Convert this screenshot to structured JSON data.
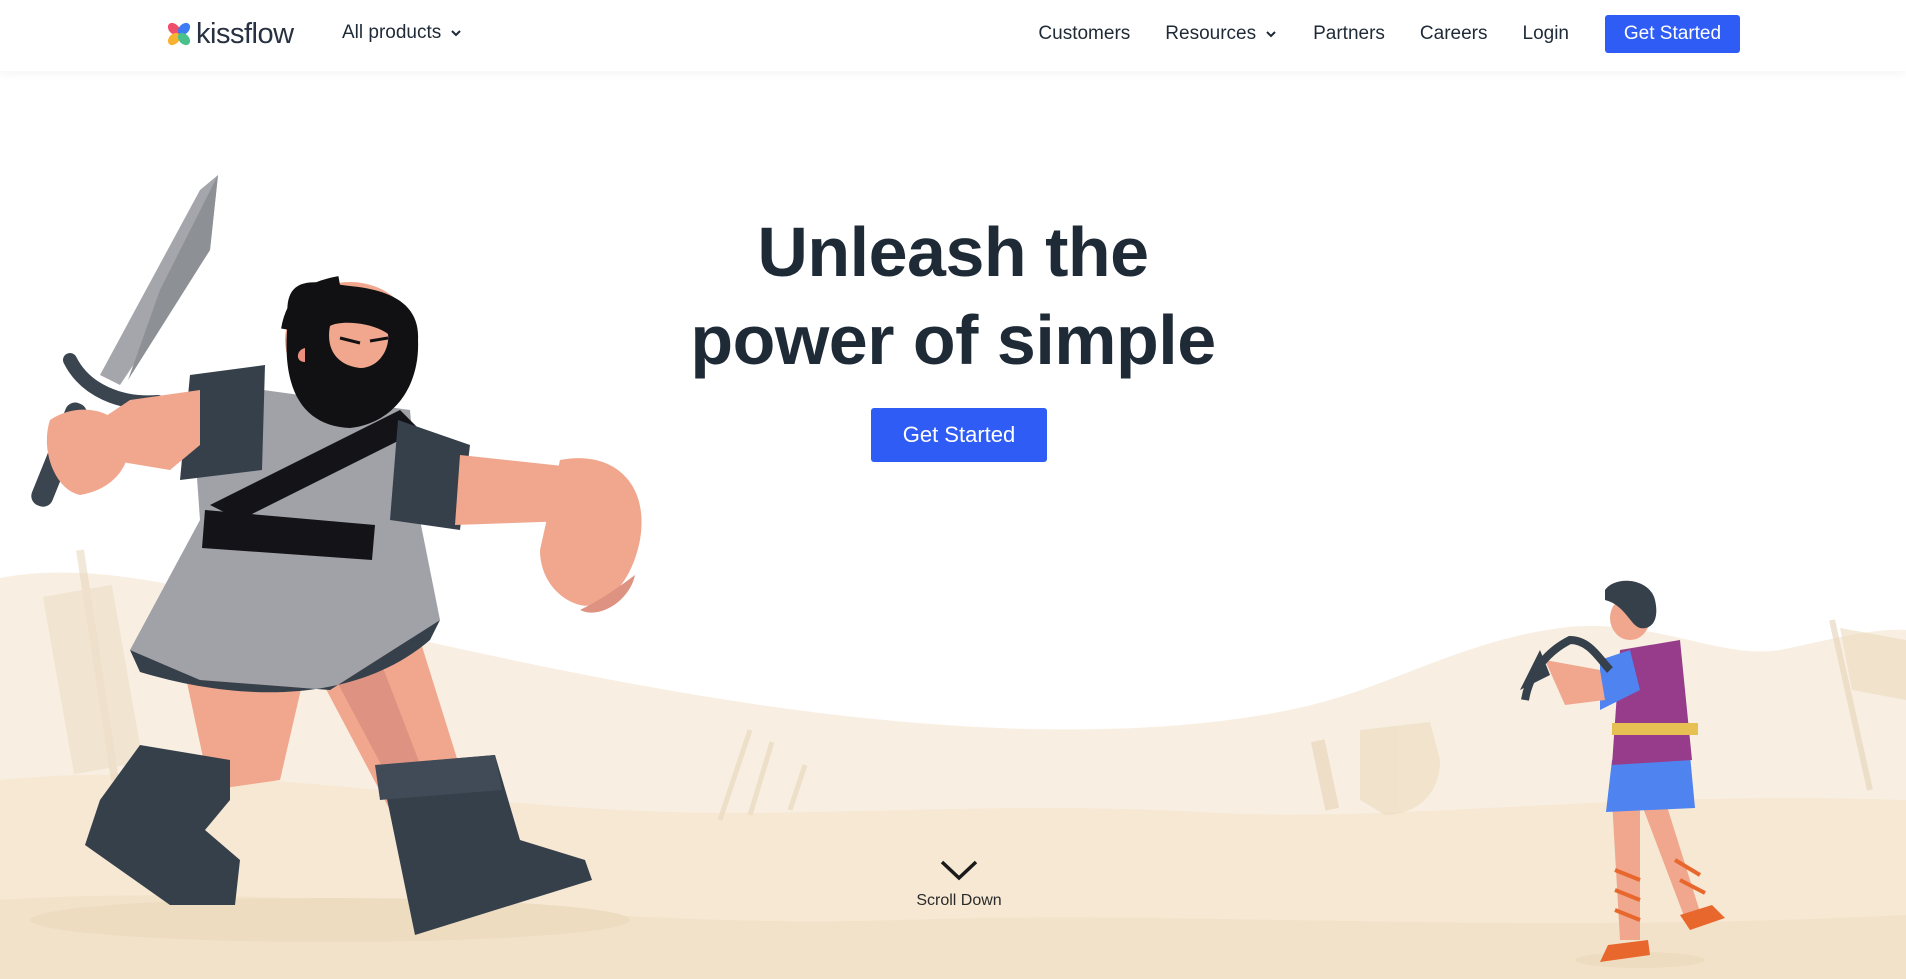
{
  "brand": {
    "name": "kissflow"
  },
  "nav": {
    "all_products": "All products",
    "links": [
      "Customers",
      "Resources",
      "Partners",
      "Careers",
      "Login"
    ],
    "cta": "Get Started"
  },
  "hero": {
    "title_line1": "Unleash the",
    "title_line2": "power of simple",
    "cta": "Get Started"
  },
  "scroll": {
    "label": "Scroll Down"
  },
  "icons": [
    "kissflow-logo-icon",
    "chevron-down-icon",
    "scroll-down-chevron-icon"
  ],
  "colors": {
    "accent": "#2f5cf5",
    "text": "#1f2a37",
    "sand": "#f8eedf"
  }
}
